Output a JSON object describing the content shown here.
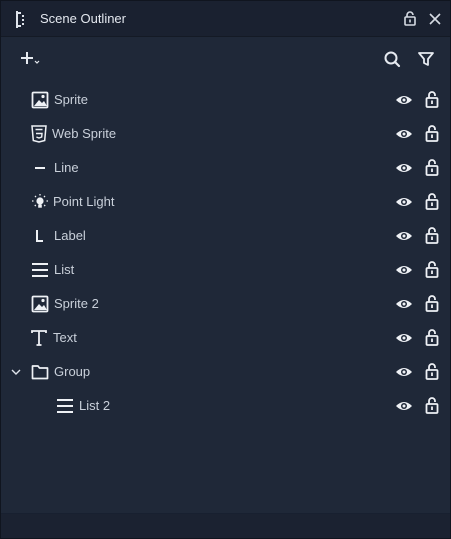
{
  "window": {
    "title": "Scene Outliner"
  },
  "colors": {
    "background": "#1f2838",
    "titlebar": "#1a2130",
    "text": "#c9d0da",
    "icon": "#e6eaf0"
  },
  "toolbar": {
    "add_icon": "plus-dropdown-icon",
    "search_icon": "search-icon",
    "filter_icon": "filter-icon"
  },
  "items": [
    {
      "label": "Sprite",
      "icon": "image-icon",
      "depth": 0
    },
    {
      "label": "Web Sprite",
      "icon": "html5-icon",
      "depth": 0
    },
    {
      "label": "Line",
      "icon": "line-icon",
      "depth": 0
    },
    {
      "label": "Point Light",
      "icon": "light-bulb-icon",
      "depth": 0
    },
    {
      "label": "Label",
      "icon": "label-icon",
      "depth": 0
    },
    {
      "label": "List",
      "icon": "list-icon",
      "depth": 0
    },
    {
      "label": "Sprite 2",
      "icon": "image-icon",
      "depth": 0
    },
    {
      "label": "Text",
      "icon": "text-icon",
      "depth": 0
    },
    {
      "label": "Group",
      "icon": "folder-icon",
      "depth": 0,
      "expanded": true
    },
    {
      "label": "List 2",
      "icon": "list-icon",
      "depth": 1
    }
  ]
}
